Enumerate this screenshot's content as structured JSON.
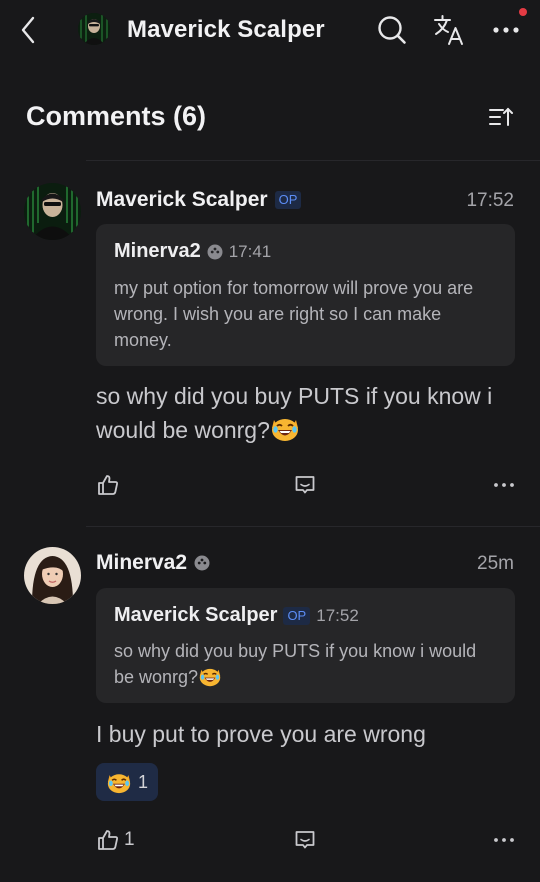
{
  "header": {
    "title": "Maverick Scalper",
    "icons": [
      "back-arrow-icon",
      "search-icon",
      "translate-icon",
      "more-icon"
    ],
    "notification_dot_color": "#e43b44"
  },
  "comments_section": {
    "title": "Comments (6)",
    "sort_icon": "sort-icon"
  },
  "comments": [
    {
      "author": "Maverick Scalper",
      "op_badge": "OP",
      "time": "17:52",
      "quote": {
        "author": "Minerva2",
        "time": "17:41",
        "text": "my put option for tomorrow will prove you are wrong. I wish you are right so I can make money."
      },
      "text": "so why did you buy PUTS if you know i would be wonrg?",
      "emoji": "laughing-cat-emoji"
    },
    {
      "author": "Minerva2",
      "time": "25m",
      "quote": {
        "author": "Maverick Scalper",
        "op_badge": "OP",
        "time": "17:52",
        "text": "so why did you buy PUTS if you know i would be wonrg?"
      },
      "text": "I buy put to prove you are wrong",
      "reaction": {
        "emoji": "laughing-cat-emoji",
        "count": "1"
      },
      "like_count": "1"
    }
  ],
  "colors": {
    "background": "#18181a",
    "quote_background": "#262628",
    "op_badge": "#5c8df5",
    "reaction_chip": "#1f2b45"
  }
}
